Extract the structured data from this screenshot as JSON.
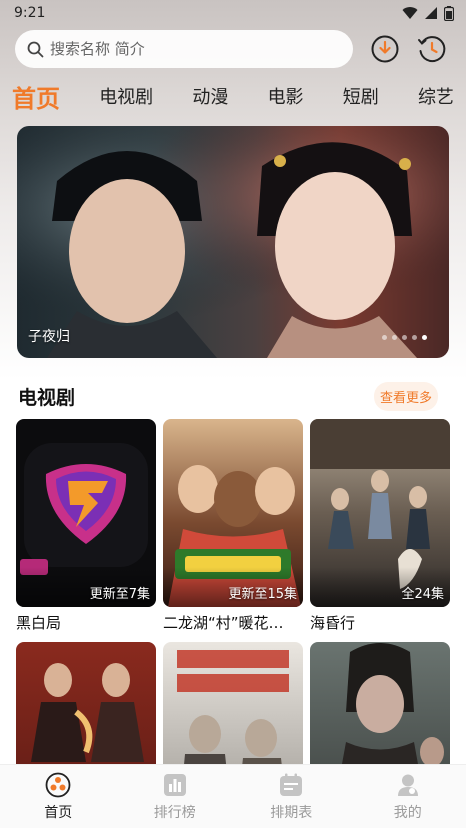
{
  "status_bar": {
    "time": "9:21"
  },
  "search": {
    "placeholder": "搜索名称 简介"
  },
  "tabs": [
    {
      "label": "首页",
      "active": true
    },
    {
      "label": "电视剧",
      "active": false
    },
    {
      "label": "动漫",
      "active": false
    },
    {
      "label": "电影",
      "active": false
    },
    {
      "label": "短剧",
      "active": false
    },
    {
      "label": "综艺",
      "active": false
    }
  ],
  "banner": {
    "caption": "子夜归",
    "dot_count": 5,
    "active_dot": 4
  },
  "section": {
    "title": "电视剧",
    "more_label": "查看更多"
  },
  "cards": [
    {
      "title": "黑白局",
      "badge": "更新至7集"
    },
    {
      "title": "二龙湖“村”暖花…",
      "badge": "更新至15集"
    },
    {
      "title": "海昏行",
      "badge": "全24集"
    },
    {
      "title": "",
      "badge": ""
    },
    {
      "title": "",
      "badge": ""
    },
    {
      "title": "",
      "badge": ""
    }
  ],
  "bottom_nav": [
    {
      "label": "首页",
      "icon": "home-icon",
      "active": true
    },
    {
      "label": "排行榜",
      "icon": "ranking-icon",
      "active": false
    },
    {
      "label": "排期表",
      "icon": "calendar-icon",
      "active": false
    },
    {
      "label": "我的",
      "icon": "profile-icon",
      "active": false
    }
  ],
  "colors": {
    "accent": "#f07a2a",
    "nav_inactive": "#9a9a9a"
  }
}
